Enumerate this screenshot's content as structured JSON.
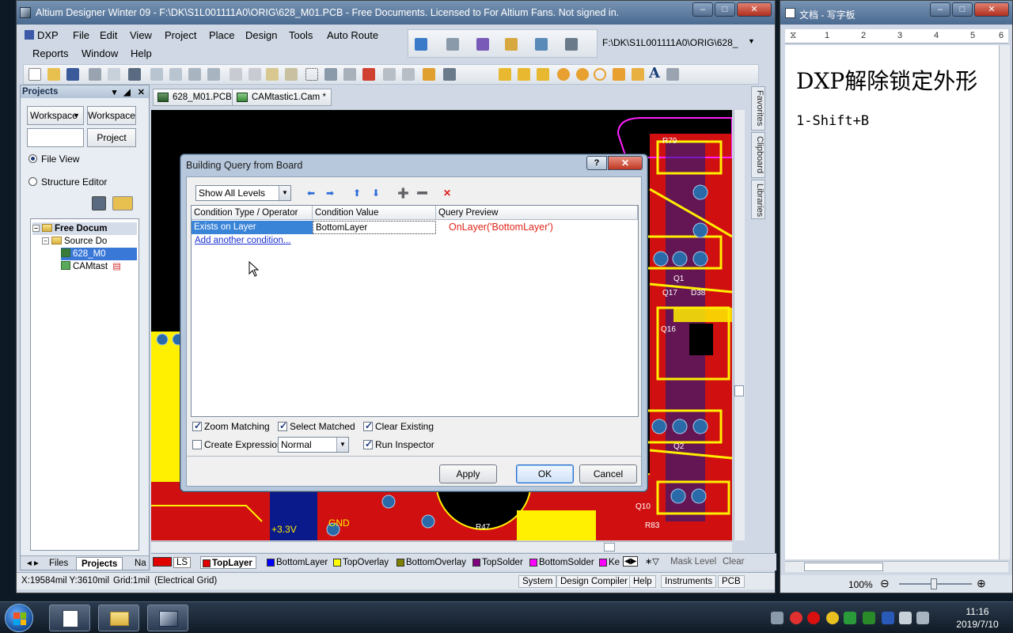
{
  "altium": {
    "window_title": "Altium Designer Winter 09 - F:\\DK\\S1L001111A0\\ORIG\\628_M01.PCB - Free Documents. Licensed to For Altium Fans. Not signed in.",
    "menu": {
      "dxp": "DXP",
      "file": "File",
      "edit": "Edit",
      "view": "View",
      "project": "Project",
      "place": "Place",
      "design": "Design",
      "tools": "Tools",
      "auto_route": "Auto Route",
      "reports": "Reports",
      "window": "Window",
      "help": "Help"
    },
    "path_field": "F:\\DK\\S1L001111A0\\ORIG\\628_",
    "doc_tabs": [
      "628_M01.PCB",
      "CAMtastic1.Cam *"
    ],
    "right_tabs": [
      "Favorites",
      "Clipboard",
      "Libraries"
    ]
  },
  "projects_panel": {
    "title": "Projects",
    "workspace_combo": "Workspace",
    "workspace_button": "Workspace",
    "project_button": "Project",
    "file_view": "File View",
    "structure_editor": "Structure Editor",
    "tree": {
      "root": "Free Docum",
      "source": "Source Do",
      "pcb_file": "628_M0",
      "cam_file": "CAMtast"
    },
    "bottom_tabs": [
      "Files",
      "Projects",
      "Na"
    ]
  },
  "dialog": {
    "title": "Building Query from Board",
    "level_combo": "Show All Levels",
    "columns": [
      "Condition Type / Operator",
      "Condition Value",
      "Query Preview"
    ],
    "condition_type": "Exists on Layer",
    "condition_value": "BottomLayer",
    "query_preview": "OnLayer('BottomLayer')",
    "add_link": "Add another condition...",
    "options": {
      "zoom_matching": "Zoom Matching",
      "select_matched": "Select Matched",
      "clear_existing": "Clear Existing",
      "create_expression": "Create Expression",
      "run_inspector": "Run Inspector",
      "mode_combo": "Normal"
    },
    "buttons": {
      "apply": "Apply",
      "ok": "OK",
      "cancel": "Cancel"
    }
  },
  "layers": {
    "ls": "LS",
    "items": [
      {
        "name": "TopLayer",
        "color": "#e00000"
      },
      {
        "name": "BottomLayer",
        "color": "#0000ff"
      },
      {
        "name": "TopOverlay",
        "color": "#ffff00"
      },
      {
        "name": "BottomOverlay",
        "color": "#808000"
      },
      {
        "name": "TopSolder",
        "color": "#800080"
      },
      {
        "name": "BottomSolder",
        "color": "#ff00ff"
      },
      {
        "name": "Ke",
        "color": "#ff00ff"
      }
    ],
    "mask_level": "Mask Level",
    "clear": "Clear"
  },
  "status": {
    "coords": "X:19584mil Y:3610mil",
    "grid": "Grid:1mil",
    "mode": "(Electrical Grid)",
    "panels": [
      "System",
      "Design Compiler",
      "Help",
      "Instruments",
      "PCB"
    ]
  },
  "pcb_labels": {
    "r79": "R79",
    "q1": "Q1",
    "q17": "Q17",
    "d38": "D38",
    "q16": "Q16",
    "q2": "Q2",
    "q10": "Q10",
    "r83": "R83",
    "r47": "R47",
    "gnd": "GND",
    "v33": "+3.3V"
  },
  "wordpad": {
    "title": "文档 - 写字板",
    "ruler": [
      "1",
      "2",
      "3",
      "4",
      "5",
      "6"
    ],
    "line1": "DXP解除锁定外形",
    "line2": "1-Shift+B",
    "zoom": "100%"
  },
  "taskbar": {
    "time": "11:16",
    "date": "2019/7/10"
  }
}
